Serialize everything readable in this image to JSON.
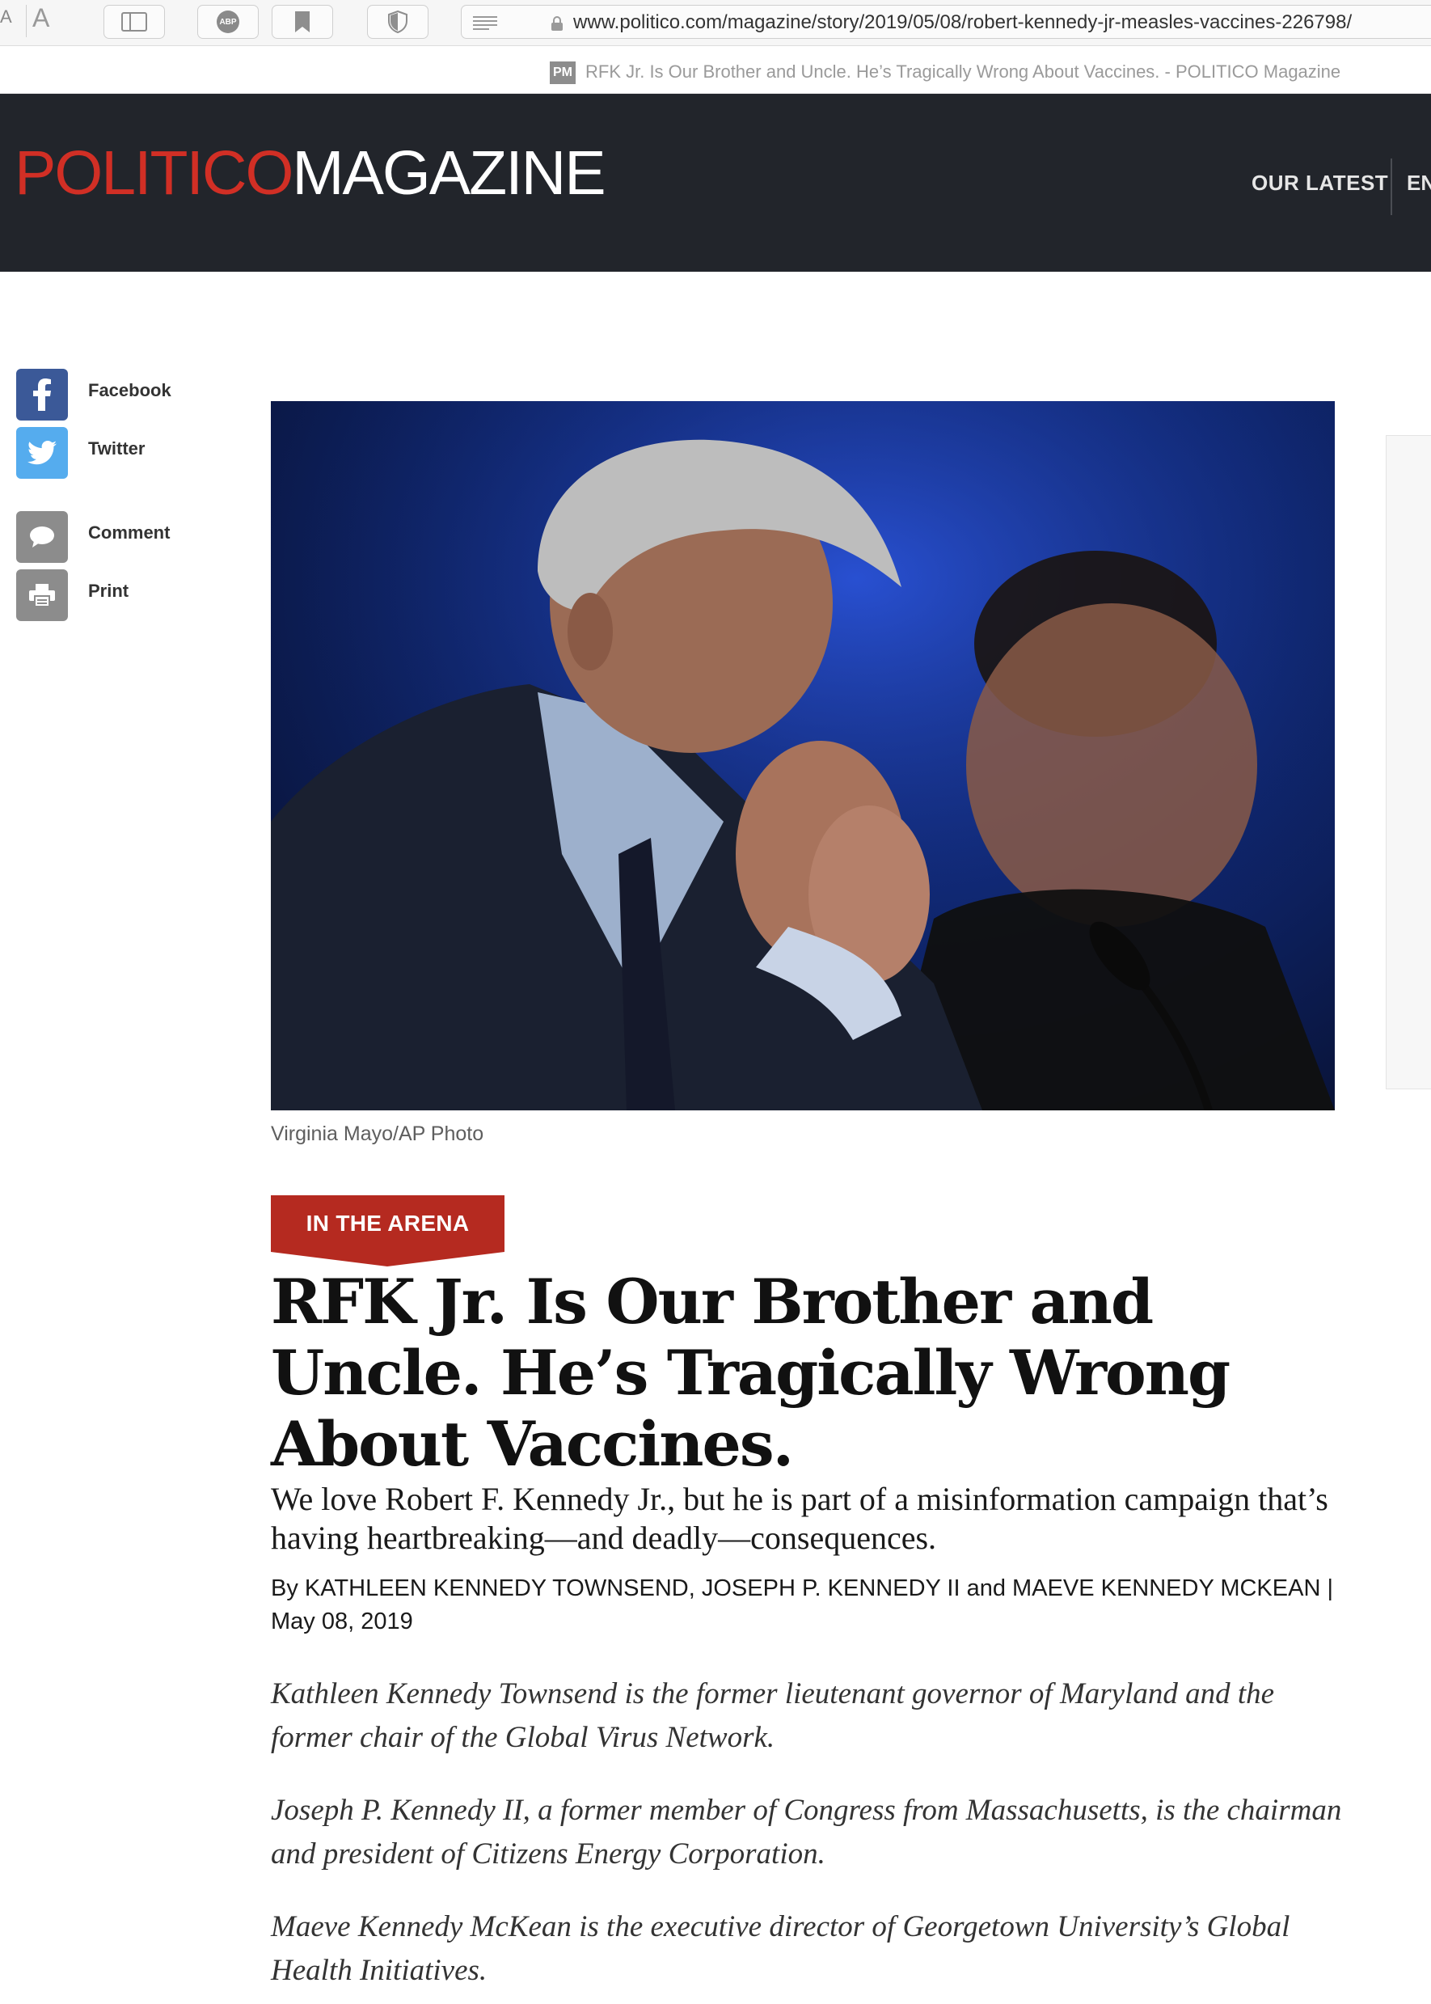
{
  "browser": {
    "font_small": "A",
    "font_large": "A",
    "adblock_label": "ABP",
    "url": "www.politico.com/magazine/story/2019/05/08/robert-kennedy-jr-measles-vaccines-226798/",
    "tab_favicon": "PM",
    "tab_title": "RFK Jr. Is Our Brother and Uncle. He’s Tragically Wrong About Vaccines. - POLITICO Magazine"
  },
  "header": {
    "logo_part1": "POLITICO",
    "logo_part2": "MAGAZINE",
    "nav_latest": "OUR LATEST",
    "nav_cut": "EN",
    "bg_color": "#22252b",
    "brand_color": "#d12f25"
  },
  "share": {
    "items": [
      {
        "label": "Facebook",
        "icon": "facebook-icon",
        "color": "#3b5998"
      },
      {
        "label": "Twitter",
        "icon": "twitter-icon",
        "color": "#55acee"
      },
      {
        "label": "Comment",
        "icon": "comment-icon",
        "color": "#8c8c8c"
      },
      {
        "label": "Print",
        "icon": "print-icon",
        "color": "#8c8c8c"
      }
    ]
  },
  "article": {
    "photo_credit": "Virginia Mayo/AP Photo",
    "kicker": "IN THE ARENA",
    "kicker_color": "#b52a20",
    "headline": "RFK Jr. Is Our Brother and Uncle. He’s Tragically Wrong About Vaccines.",
    "dek": "We love Robert F. Kennedy Jr., but he is part of a misinformation campaign that’s having heartbreaking—and deadly—consequences.",
    "byline": "By KATHLEEN KENNEDY TOWNSEND, JOSEPH P. KENNEDY II and MAEVE KENNEDY MCKEAN |",
    "date": "May 08, 2019",
    "bios": [
      "Kathleen Kennedy Townsend is the former lieutenant governor of Maryland and the former chair of the Global Virus Network.",
      "Joseph P. Kennedy II, a former member of Congress from Massachusetts, is the chairman and president of Citizens Energy Corporation.",
      "Maeve Kennedy McKean is the executive director of Georgetown University’s Global Health Initiatives."
    ]
  }
}
